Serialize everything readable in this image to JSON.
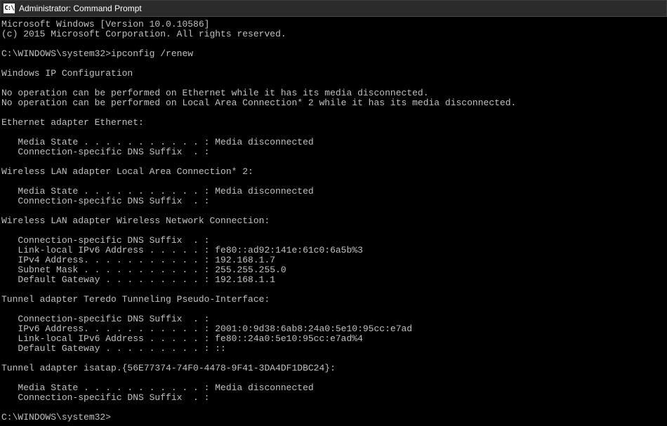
{
  "window": {
    "title": "Administrator: Command Prompt",
    "icon_label": "C:\\"
  },
  "lines": [
    "Microsoft Windows [Version 10.0.10586]",
    "(c) 2015 Microsoft Corporation. All rights reserved.",
    "",
    "C:\\WINDOWS\\system32>ipconfig /renew",
    "",
    "Windows IP Configuration",
    "",
    "No operation can be performed on Ethernet while it has its media disconnected.",
    "No operation can be performed on Local Area Connection* 2 while it has its media disconnected.",
    "",
    "Ethernet adapter Ethernet:",
    "",
    "   Media State . . . . . . . . . . . : Media disconnected",
    "   Connection-specific DNS Suffix  . :",
    "",
    "Wireless LAN adapter Local Area Connection* 2:",
    "",
    "   Media State . . . . . . . . . . . : Media disconnected",
    "   Connection-specific DNS Suffix  . :",
    "",
    "Wireless LAN adapter Wireless Network Connection:",
    "",
    "   Connection-specific DNS Suffix  . :",
    "   Link-local IPv6 Address . . . . . : fe80::ad92:141e:61c0:6a5b%3",
    "   IPv4 Address. . . . . . . . . . . : 192.168.1.7",
    "   Subnet Mask . . . . . . . . . . . : 255.255.255.0",
    "   Default Gateway . . . . . . . . . : 192.168.1.1",
    "",
    "Tunnel adapter Teredo Tunneling Pseudo-Interface:",
    "",
    "   Connection-specific DNS Suffix  . :",
    "   IPv6 Address. . . . . . . . . . . : 2001:0:9d38:6ab8:24a0:5e10:95cc:e7ad",
    "   Link-local IPv6 Address . . . . . : fe80::24a0:5e10:95cc:e7ad%4",
    "   Default Gateway . . . . . . . . . : ::",
    "",
    "Tunnel adapter isatap.{56E77374-74F0-4478-9F41-3DA4DF1DBC24}:",
    "",
    "   Media State . . . . . . . . . . . : Media disconnected",
    "   Connection-specific DNS Suffix  . :",
    "",
    "C:\\WINDOWS\\system32>"
  ]
}
